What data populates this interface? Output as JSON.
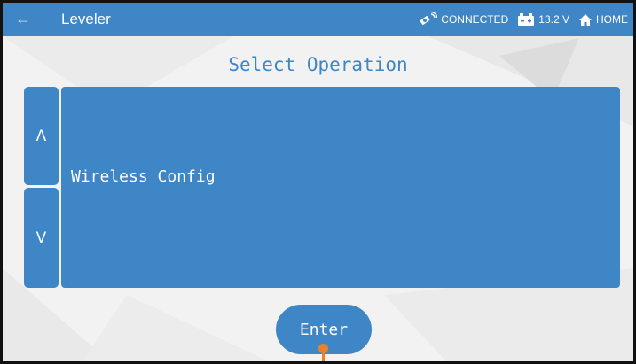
{
  "app": {
    "title": "Leveler",
    "back_icon": "arrow-left-icon"
  },
  "status": {
    "connection": "CONNECTED",
    "connection_icon": "satellite-icon",
    "battery_voltage": "13.2 V",
    "battery_icon": "battery-icon",
    "home_label": "HOME",
    "home_icon": "home-icon"
  },
  "main": {
    "heading": "Select Operation",
    "up_arrow": "Λ",
    "down_arrow": "V",
    "selected_item": "Wireless Config",
    "enter_label": "Enter"
  },
  "colors": {
    "accent": "#3f86c7",
    "pointer": "#e8822c"
  }
}
